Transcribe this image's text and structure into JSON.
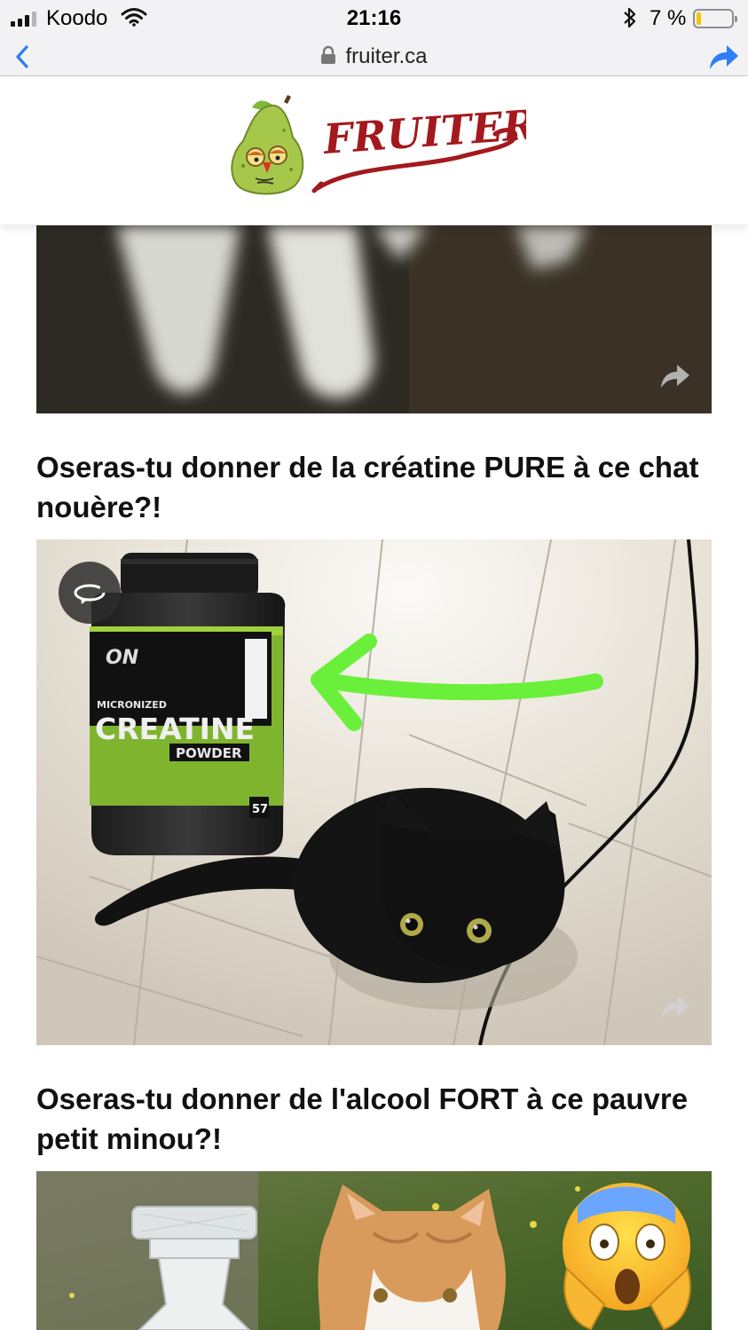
{
  "status_bar": {
    "carrier": "Koodo",
    "time": "21:16",
    "battery_percent": "7 %",
    "battery_level": 0.07,
    "signal_bars": 3
  },
  "browser": {
    "url": "fruiter.ca",
    "back_icon": "chevron-left-icon",
    "share_icon": "share-arrow-icon"
  },
  "site": {
    "logo_text": "FRUITER"
  },
  "feed": {
    "posts": [
      {
        "title": "Oseras-tu donner de la créatine PURE à ce chat nouère?!",
        "product": {
          "brand": "ON",
          "line1": "MICRONIZED",
          "line2": "CREATINE",
          "line3": "POWDER",
          "servings": "57"
        }
      },
      {
        "title": "Oseras-tu donner de l'alcool FORT à ce pauvre petit minou?!"
      }
    ]
  },
  "colors": {
    "accent_blue": "#2e7cf6",
    "logo_red": "#a3191d",
    "arrow_green": "#6af03a"
  }
}
